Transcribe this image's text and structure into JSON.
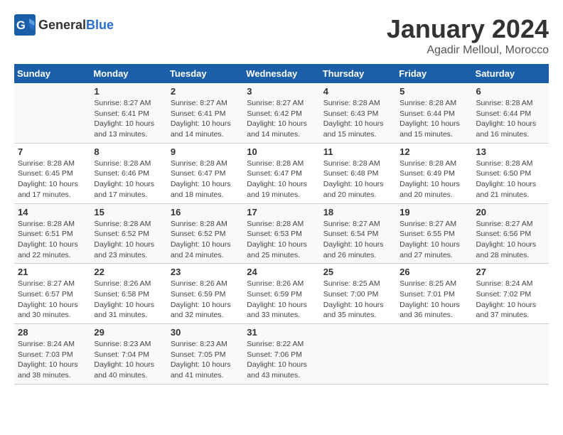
{
  "header": {
    "logo_general": "General",
    "logo_blue": "Blue",
    "title": "January 2024",
    "subtitle": "Agadir Melloul, Morocco"
  },
  "weekdays": [
    "Sunday",
    "Monday",
    "Tuesday",
    "Wednesday",
    "Thursday",
    "Friday",
    "Saturday"
  ],
  "weeks": [
    [
      {
        "day": "",
        "info": ""
      },
      {
        "day": "1",
        "info": "Sunrise: 8:27 AM\nSunset: 6:41 PM\nDaylight: 10 hours\nand 13 minutes."
      },
      {
        "day": "2",
        "info": "Sunrise: 8:27 AM\nSunset: 6:41 PM\nDaylight: 10 hours\nand 14 minutes."
      },
      {
        "day": "3",
        "info": "Sunrise: 8:27 AM\nSunset: 6:42 PM\nDaylight: 10 hours\nand 14 minutes."
      },
      {
        "day": "4",
        "info": "Sunrise: 8:28 AM\nSunset: 6:43 PM\nDaylight: 10 hours\nand 15 minutes."
      },
      {
        "day": "5",
        "info": "Sunrise: 8:28 AM\nSunset: 6:44 PM\nDaylight: 10 hours\nand 15 minutes."
      },
      {
        "day": "6",
        "info": "Sunrise: 8:28 AM\nSunset: 6:44 PM\nDaylight: 10 hours\nand 16 minutes."
      }
    ],
    [
      {
        "day": "7",
        "info": "Sunrise: 8:28 AM\nSunset: 6:45 PM\nDaylight: 10 hours\nand 17 minutes."
      },
      {
        "day": "8",
        "info": "Sunrise: 8:28 AM\nSunset: 6:46 PM\nDaylight: 10 hours\nand 17 minutes."
      },
      {
        "day": "9",
        "info": "Sunrise: 8:28 AM\nSunset: 6:47 PM\nDaylight: 10 hours\nand 18 minutes."
      },
      {
        "day": "10",
        "info": "Sunrise: 8:28 AM\nSunset: 6:47 PM\nDaylight: 10 hours\nand 19 minutes."
      },
      {
        "day": "11",
        "info": "Sunrise: 8:28 AM\nSunset: 6:48 PM\nDaylight: 10 hours\nand 20 minutes."
      },
      {
        "day": "12",
        "info": "Sunrise: 8:28 AM\nSunset: 6:49 PM\nDaylight: 10 hours\nand 20 minutes."
      },
      {
        "day": "13",
        "info": "Sunrise: 8:28 AM\nSunset: 6:50 PM\nDaylight: 10 hours\nand 21 minutes."
      }
    ],
    [
      {
        "day": "14",
        "info": "Sunrise: 8:28 AM\nSunset: 6:51 PM\nDaylight: 10 hours\nand 22 minutes."
      },
      {
        "day": "15",
        "info": "Sunrise: 8:28 AM\nSunset: 6:52 PM\nDaylight: 10 hours\nand 23 minutes."
      },
      {
        "day": "16",
        "info": "Sunrise: 8:28 AM\nSunset: 6:52 PM\nDaylight: 10 hours\nand 24 minutes."
      },
      {
        "day": "17",
        "info": "Sunrise: 8:28 AM\nSunset: 6:53 PM\nDaylight: 10 hours\nand 25 minutes."
      },
      {
        "day": "18",
        "info": "Sunrise: 8:27 AM\nSunset: 6:54 PM\nDaylight: 10 hours\nand 26 minutes."
      },
      {
        "day": "19",
        "info": "Sunrise: 8:27 AM\nSunset: 6:55 PM\nDaylight: 10 hours\nand 27 minutes."
      },
      {
        "day": "20",
        "info": "Sunrise: 8:27 AM\nSunset: 6:56 PM\nDaylight: 10 hours\nand 28 minutes."
      }
    ],
    [
      {
        "day": "21",
        "info": "Sunrise: 8:27 AM\nSunset: 6:57 PM\nDaylight: 10 hours\nand 30 minutes."
      },
      {
        "day": "22",
        "info": "Sunrise: 8:26 AM\nSunset: 6:58 PM\nDaylight: 10 hours\nand 31 minutes."
      },
      {
        "day": "23",
        "info": "Sunrise: 8:26 AM\nSunset: 6:59 PM\nDaylight: 10 hours\nand 32 minutes."
      },
      {
        "day": "24",
        "info": "Sunrise: 8:26 AM\nSunset: 6:59 PM\nDaylight: 10 hours\nand 33 minutes."
      },
      {
        "day": "25",
        "info": "Sunrise: 8:25 AM\nSunset: 7:00 PM\nDaylight: 10 hours\nand 35 minutes."
      },
      {
        "day": "26",
        "info": "Sunrise: 8:25 AM\nSunset: 7:01 PM\nDaylight: 10 hours\nand 36 minutes."
      },
      {
        "day": "27",
        "info": "Sunrise: 8:24 AM\nSunset: 7:02 PM\nDaylight: 10 hours\nand 37 minutes."
      }
    ],
    [
      {
        "day": "28",
        "info": "Sunrise: 8:24 AM\nSunset: 7:03 PM\nDaylight: 10 hours\nand 38 minutes."
      },
      {
        "day": "29",
        "info": "Sunrise: 8:23 AM\nSunset: 7:04 PM\nDaylight: 10 hours\nand 40 minutes."
      },
      {
        "day": "30",
        "info": "Sunrise: 8:23 AM\nSunset: 7:05 PM\nDaylight: 10 hours\nand 41 minutes."
      },
      {
        "day": "31",
        "info": "Sunrise: 8:22 AM\nSunset: 7:06 PM\nDaylight: 10 hours\nand 43 minutes."
      },
      {
        "day": "",
        "info": ""
      },
      {
        "day": "",
        "info": ""
      },
      {
        "day": "",
        "info": ""
      }
    ]
  ]
}
